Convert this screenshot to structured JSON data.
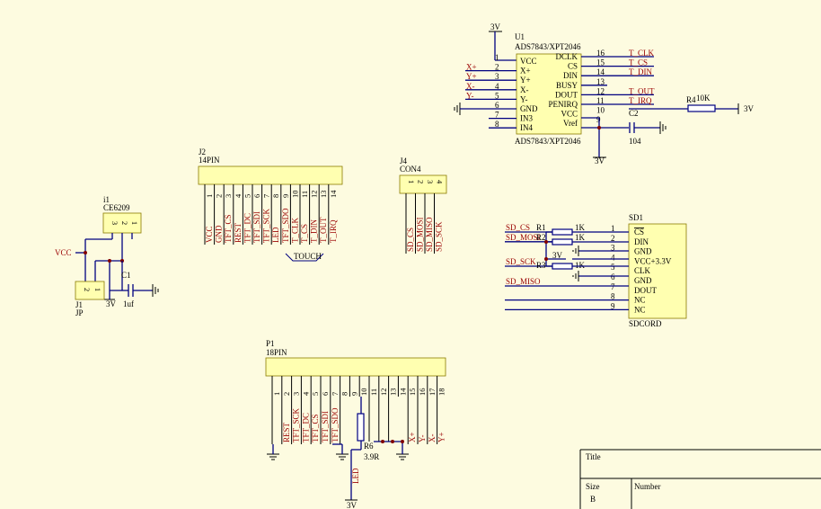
{
  "schematic": {
    "u1": {
      "designator": "U1",
      "part": "ADS7843/XPT2046",
      "supply": "3V",
      "left_pins": [
        {
          "num": "1",
          "name": "VCC",
          "net": ""
        },
        {
          "num": "2",
          "name": "X+",
          "net": "X+"
        },
        {
          "num": "3",
          "name": "Y+",
          "net": "Y+"
        },
        {
          "num": "4",
          "name": "X-",
          "net": "X-"
        },
        {
          "num": "5",
          "name": "Y-",
          "net": "Y-"
        },
        {
          "num": "6",
          "name": "GND",
          "net": ""
        },
        {
          "num": "7",
          "name": "IN3",
          "net": ""
        },
        {
          "num": "8",
          "name": "IN4",
          "net": ""
        }
      ],
      "right_pins": [
        {
          "num": "16",
          "name": "DCLK",
          "net": "T_CLK"
        },
        {
          "num": "15",
          "name": "CS",
          "net": "T_CS"
        },
        {
          "num": "14",
          "name": "DIN",
          "net": "T_DIN"
        },
        {
          "num": "13",
          "name": "BUSY",
          "net": ""
        },
        {
          "num": "12",
          "name": "DOUT",
          "net": "T_OUT"
        },
        {
          "num": "11",
          "name": "PENIRQ",
          "net": "T_IRQ"
        },
        {
          "num": "10",
          "name": "VCC",
          "net": ""
        },
        {
          "num": "9",
          "name": "Vref",
          "net": ""
        }
      ],
      "r4": {
        "designator": "R4",
        "value": "10K",
        "net": "3V"
      },
      "c2": {
        "designator": "C2",
        "value": "104"
      },
      "vref_supply": "3V"
    },
    "j2": {
      "designator": "J2",
      "part": "14PIN",
      "pins": [
        "1",
        "2",
        "3",
        "4",
        "5",
        "6",
        "7",
        "8",
        "9",
        "10",
        "11",
        "12",
        "13",
        "14"
      ],
      "signals": [
        "VCC",
        "GND",
        "TFT_CS",
        "REST",
        "TFT_DC",
        "TFT_SDI",
        "TFT_SCK",
        "LED",
        "TFT_SDO",
        "T_CLK",
        "T_CS",
        "T_DIN",
        "T_OUT",
        "T_IRQ"
      ],
      "touch_label": "TOUCH"
    },
    "j4": {
      "designator": "J4",
      "part": "CON4",
      "pins": [
        "1",
        "2",
        "3",
        "4"
      ],
      "signals": [
        "SD_CS",
        "SD_MOSI",
        "SD_MISO",
        "SD_SCK"
      ]
    },
    "i1": {
      "designator": "i1",
      "part": "CE6209",
      "pins": [
        "3",
        "2",
        "1"
      ],
      "vcc": "VCC",
      "out": "3V"
    },
    "c1": {
      "designator": "C1",
      "value": "1uf"
    },
    "j1": {
      "designator": "J1",
      "part": "JP",
      "pins": [
        "2",
        "1"
      ]
    },
    "sd1": {
      "designator": "SD1",
      "part": "SDCORD",
      "pins": [
        {
          "num": "1",
          "name": "CS",
          "net": "SD_CS"
        },
        {
          "num": "2",
          "name": "DIN",
          "net": "SD_MOSI"
        },
        {
          "num": "3",
          "name": "GND",
          "net": ""
        },
        {
          "num": "4",
          "name": "VCC+3.3V",
          "net": ""
        },
        {
          "num": "5",
          "name": "CLK",
          "net": "SD_SCK"
        },
        {
          "num": "6",
          "name": "GND",
          "net": ""
        },
        {
          "num": "7",
          "name": "DOUT",
          "net": "SD_MISO"
        },
        {
          "num": "8",
          "name": "NC",
          "net": ""
        },
        {
          "num": "9",
          "name": "NC",
          "net": ""
        }
      ],
      "resistors": [
        {
          "designator": "R1",
          "value": "1K"
        },
        {
          "designator": "R2",
          "value": "1K"
        },
        {
          "designator": "R3",
          "value": "1K"
        }
      ],
      "supply": "3V"
    },
    "p1": {
      "designator": "P1",
      "part": "18PIN",
      "pins": [
        "1",
        "2",
        "3",
        "4",
        "5",
        "6",
        "7",
        "8",
        "9",
        "10",
        "11",
        "12",
        "13",
        "14",
        "15",
        "16",
        "17",
        "18"
      ],
      "signals": [
        "",
        "REST",
        "TFT_SCK",
        "TFT_DC",
        "TFT_CS",
        "TFT_SDI",
        "TFT_SDO",
        "",
        "",
        "",
        "",
        "",
        "",
        "",
        "X+",
        "Y-",
        "X-",
        "Y+"
      ],
      "r6": {
        "designator": "R6",
        "value": "3.9R"
      },
      "led_net": "LED",
      "supply": "3V"
    },
    "title_block": {
      "title_label": "Title",
      "size_label": "Size",
      "size_value": "B",
      "number_label": "Number"
    }
  }
}
